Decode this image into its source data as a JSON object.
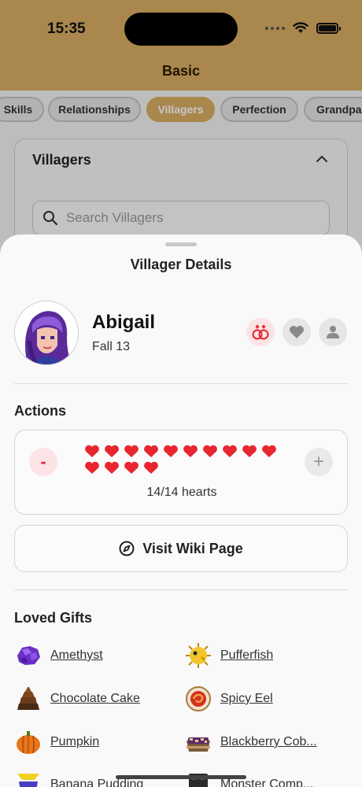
{
  "status_bar": {
    "time": "15:35"
  },
  "screen": {
    "title": "Basic"
  },
  "tabs": [
    {
      "label": "Skills",
      "active": false
    },
    {
      "label": "Relationships",
      "active": false
    },
    {
      "label": "Villagers",
      "active": true
    },
    {
      "label": "Perfection",
      "active": false
    },
    {
      "label": "Grandpa's",
      "active": false
    }
  ],
  "villagers_card": {
    "title": "Villagers",
    "search_placeholder": "Search Villagers"
  },
  "sheet": {
    "title": "Villager Details",
    "villager": {
      "name": "Abigail",
      "birthday": "Fall 13"
    },
    "actions_label": "Actions",
    "hearts": {
      "filled": 14,
      "total": 14,
      "text": "14/14 hearts",
      "minus_label": "-",
      "plus_label": "+"
    },
    "wiki_button_label": "Visit Wiki Page",
    "loved_gifts_label": "Loved Gifts",
    "loved_gifts": [
      {
        "name": "Amethyst",
        "icon": "amethyst-icon"
      },
      {
        "name": "Pufferfish",
        "icon": "pufferfish-icon"
      },
      {
        "name": "Chocolate Cake",
        "icon": "chocolate-cake-icon"
      },
      {
        "name": "Spicy Eel",
        "icon": "spicy-eel-icon"
      },
      {
        "name": "Pumpkin",
        "icon": "pumpkin-icon"
      },
      {
        "name": "Blackberry Cob...",
        "icon": "blackberry-cobbler-icon"
      },
      {
        "name": "Banana Pudding",
        "icon": "banana-pudding-icon"
      },
      {
        "name": "Monster Comp...",
        "icon": "monster-compendium-icon"
      }
    ]
  },
  "colors": {
    "header": "#d9ae63",
    "heart": "#e8262f",
    "accent_pink": "#fbe3e6"
  }
}
